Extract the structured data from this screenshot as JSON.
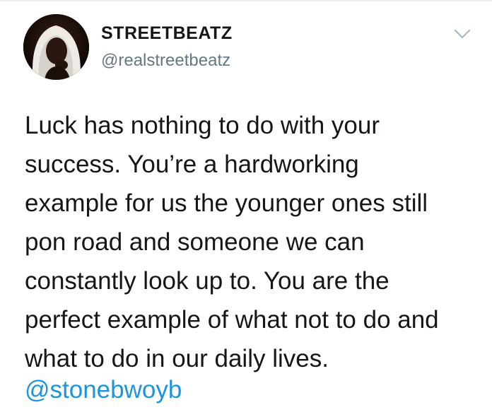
{
  "tweet": {
    "author": {
      "display_name": "STREETBEATZ",
      "handle": "@realstreetbeatz",
      "avatar_icon": "profile-photo"
    },
    "menu_icon": "chevron-down-icon",
    "text_lines": [
      "Luck has nothing to do with your",
      "success. You’re a hardworking",
      "example for us the younger ones still",
      "pon road and someone we can",
      "constantly look up to. You are the",
      "perfect example of what not to do and",
      "what to do in our daily lives."
    ],
    "mention": "@stonebwoyb"
  },
  "colors": {
    "text": "#14171a",
    "secondary": "#657786",
    "link": "#1b95e0",
    "chevron": "#aab8c2"
  }
}
